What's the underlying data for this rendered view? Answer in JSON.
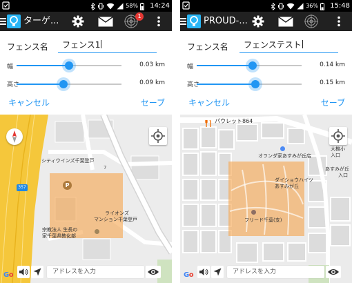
{
  "colors": {
    "accent": "#2196f3",
    "actionbar": "#212121",
    "fence_fill": "#f5a650",
    "badge": "#e53935",
    "logo": "#29b6f6"
  },
  "left": {
    "status": {
      "battery": "58%",
      "time": "14:24"
    },
    "actionbar": {
      "title": "ターゲ...",
      "badge": "1",
      "icons": [
        "menu-icon",
        "app-logo-icon",
        "gear-icon",
        "mail-icon",
        "radar-icon",
        "more-vert-icon"
      ]
    },
    "form": {
      "fence_label": "フェンス名",
      "fence_value": "フェンス1",
      "width_label": "幅",
      "width_value": "0.03 km",
      "width_fraction": 0.5,
      "height_label": "高さ",
      "height_value": "0.09 km",
      "height_fraction": 0.45,
      "cancel": "キャンセル",
      "save": "セーブ"
    },
    "map": {
      "labels": {
        "city_wings": "シティウインズ千葉登戸",
        "lions_1": "ライオンズ",
        "lions_2": "マンション千葉登戸",
        "religious_1": "宗教法人 生長の",
        "religious_2": "家千葉県教化部",
        "route": "357",
        "num": "7",
        "parking": "P"
      },
      "address_placeholder": "アドレスを入力",
      "google": "Google"
    }
  },
  "right": {
    "status": {
      "battery": "36%",
      "time": "15:48"
    },
    "actionbar": {
      "title": "PROUD-...",
      "icons": [
        "menu-icon",
        "app-logo-icon",
        "gear-icon",
        "mail-icon",
        "radar-icon",
        "more-vert-icon"
      ]
    },
    "form": {
      "fence_label": "フェンス名",
      "fence_value": "フェンステスト",
      "width_label": "幅",
      "width_value": "0.14 km",
      "width_fraction": 0.53,
      "height_label": "高さ",
      "height_value": "0.15 km",
      "height_fraction": 0.56,
      "cancel": "キャンセル",
      "save": "セーブ"
    },
    "map": {
      "labels": {
        "pauletto": "パウレット864",
        "orange_1": "オランダ家あすみが丘店",
        "daishowa_1": "ダイショウハイツ",
        "daishowa_2": "あすみが丘",
        "freed": "フリード千葉(支)",
        "oshi_1": "大椎小",
        "oshi_2": "入口",
        "asumi_1": "あすみが丘",
        "asumi_2": "入口"
      },
      "address_placeholder": "アドレスを入力",
      "google": "Google"
    }
  }
}
